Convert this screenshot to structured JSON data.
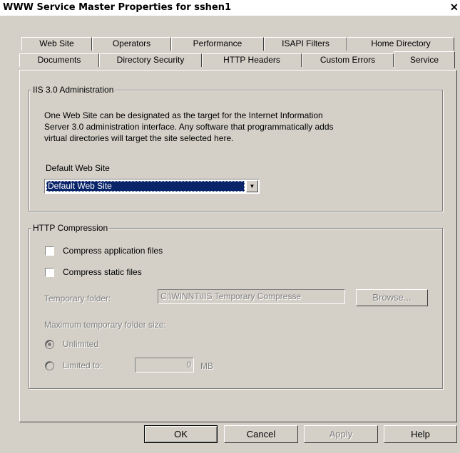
{
  "window": {
    "title": "WWW Service Master Properties for sshen1",
    "close_glyph": "✕"
  },
  "tabs_row1": [
    "Web Site",
    "Operators",
    "Performance",
    "ISAPI Filters",
    "Home Directory"
  ],
  "tabs_row2": [
    "Documents",
    "Directory Security",
    "HTTP Headers",
    "Custom Errors",
    "Service"
  ],
  "active_tab": "Service",
  "iis_group": {
    "label": "IIS 3.0 Administration",
    "description_lines": [
      "One Web Site can be designated as the target for the Internet Information",
      "Server 3.0 administration interface.  Any software that programmatically adds",
      "virtual directories will target the site selected here."
    ],
    "default_site_label": "Default Web Site",
    "default_site_value": "Default Web Site"
  },
  "compression_group": {
    "label": "HTTP Compression",
    "compress_app_label": "Compress application files",
    "compress_app_checked": false,
    "compress_static_label": "Compress static files",
    "compress_static_checked": false,
    "temp_folder_label": "Temporary folder:",
    "temp_folder_value": "C:\\WINNT\\IIS Temporary Compresse",
    "browse_label": "Browse...",
    "max_size_label": "Maximum temporary folder size:",
    "unlimited_label": "Unlimited",
    "unlimited_selected": true,
    "limited_label": "Limited to:",
    "limited_value": "0",
    "unit_label": "MB"
  },
  "buttons": {
    "ok": "OK",
    "cancel": "Cancel",
    "apply": "Apply",
    "help": "Help"
  }
}
